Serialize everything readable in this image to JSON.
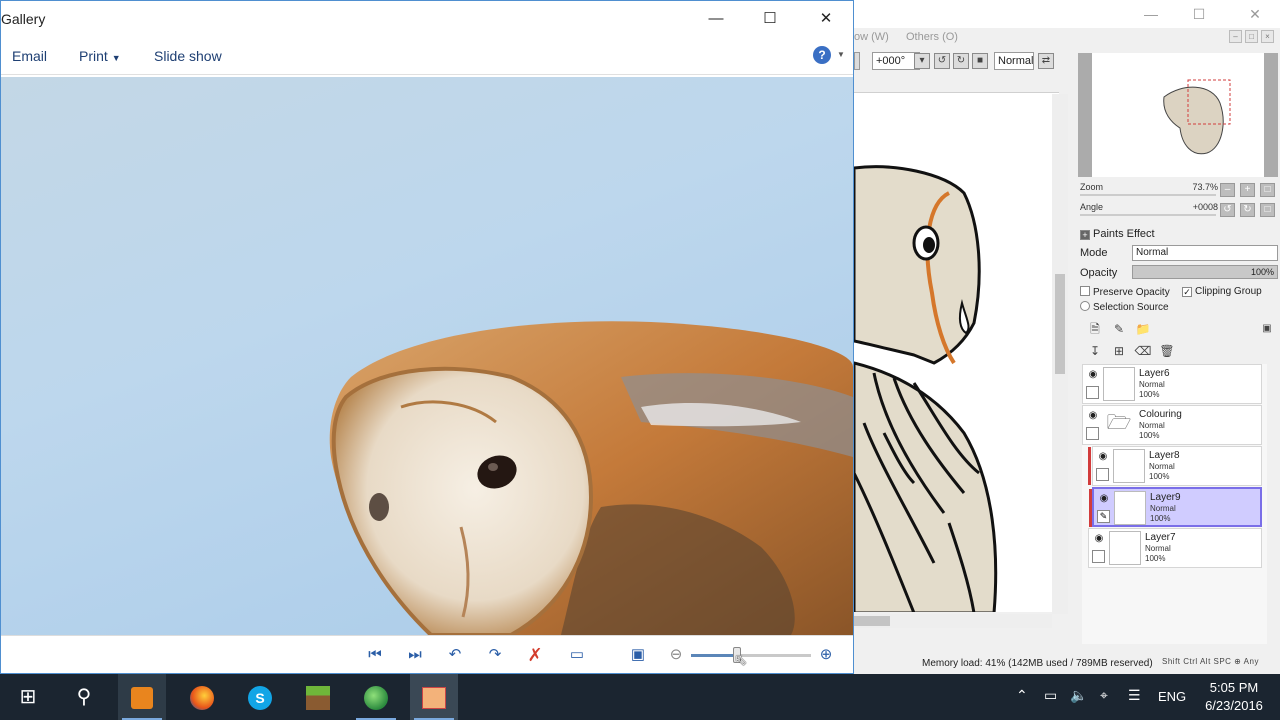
{
  "sai": {
    "menu_partial": "ow (W)",
    "menu_others": "Others (O)",
    "angle_value": "+000°",
    "blend_mode": "Normal",
    "navigator": {
      "zoom_label": "Zoom",
      "zoom_value": "73.7%",
      "angle_label": "Angle",
      "angle_value": "+0008"
    },
    "paints_effect_label": "Paints Effect",
    "mode_label": "Mode",
    "mode_value": "Normal",
    "opacity_label": "Opacity",
    "opacity_value": "100%",
    "preserve_opacity_label": "Preserve Opacity",
    "clipping_group_label": "Clipping Group",
    "selection_source_label": "Selection Source",
    "layers": [
      {
        "name": "Layer6",
        "mode": "Normal",
        "opacity": "100%"
      },
      {
        "name": "Colouring",
        "mode": "Normal",
        "opacity": "100%"
      },
      {
        "name": "Layer8",
        "mode": "Normal",
        "opacity": "100%"
      },
      {
        "name": "Layer9",
        "mode": "Normal",
        "opacity": "100%"
      },
      {
        "name": "Layer7",
        "mode": "Normal",
        "opacity": "100%"
      }
    ],
    "memory_load": "Memory load: 41% (142MB used / 789MB reserved)",
    "status_keys": "Shift Ctrl Alt SPC ⊕ Any"
  },
  "gallery": {
    "title": "Gallery",
    "menu": {
      "email": "Email",
      "print": "Print",
      "slideshow": "Slide show"
    },
    "help_glyph": "?",
    "zoom_level": 0.38
  },
  "taskbar": {
    "language": "ENG",
    "time": "5:05 PM",
    "date": "6/23/2016"
  },
  "icons": {
    "start": "windows-logo-icon",
    "search": "search-icon",
    "media": "media-player-icon",
    "firefox": "firefox-icon",
    "skype": "skype-icon",
    "minecraft": "minecraft-icon",
    "globe": "globe-app-icon",
    "sai": "paint-tool-sai-icon"
  },
  "colors": {
    "gallery_border": "#4f8fd0",
    "selected_layer": "#d0ccff",
    "clipping_bar": "#d23c3c",
    "taskbar": "#1b2530"
  }
}
